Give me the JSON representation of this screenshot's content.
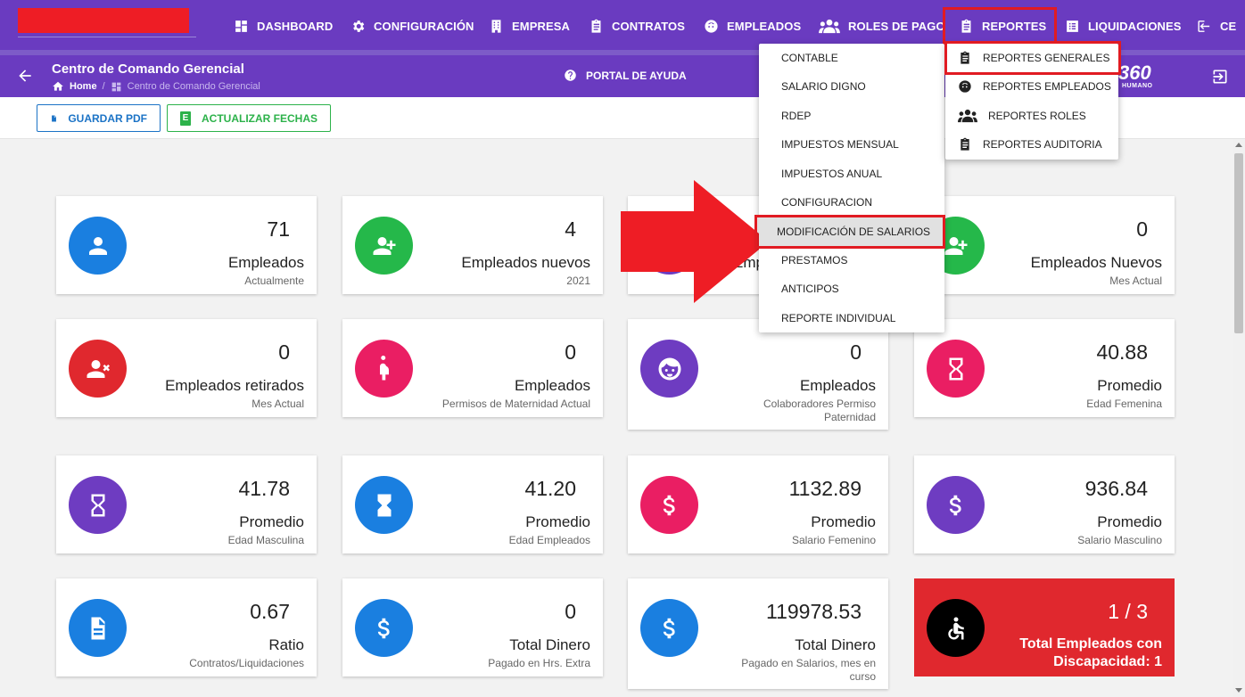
{
  "nav": {
    "items": [
      {
        "label": "DASHBOARD",
        "icon": "dashboard-icon"
      },
      {
        "label": "CONFIGURACIÓN",
        "icon": "gear-icon"
      },
      {
        "label": "EMPRESA",
        "icon": "building-icon"
      },
      {
        "label": "CONTRATOS",
        "icon": "clipboard-icon"
      },
      {
        "label": "EMPLEADOS",
        "icon": "face-icon"
      },
      {
        "label": "ROLES DE PAGO",
        "icon": "group-icon"
      },
      {
        "label": "REPORTES",
        "icon": "clipboard-icon"
      },
      {
        "label": "LIQUIDACIONES",
        "icon": "list-icon"
      },
      {
        "label": "CE",
        "icon": "exit-icon"
      }
    ]
  },
  "subheader": {
    "title": "Centro de Comando Gerencial",
    "breadcrumb_home": "Home",
    "breadcrumb_sep": "/",
    "breadcrumb_current": "Centro de Comando Gerencial",
    "help_label": "PORTAL DE AYUDA",
    "brand": "360",
    "brand_sub": "HUMANO"
  },
  "toolbar": {
    "pdf_label": "GUARDAR PDF",
    "excel_letter": "E",
    "dates_label": "ACTUALIZAR FECHAS"
  },
  "dropdown_contratos": {
    "items": [
      "CONTABLE",
      "SALARIO DIGNO",
      "RDEP",
      "IMPUESTOS MENSUAL",
      "IMPUESTOS ANUAL",
      "CONFIGURACION",
      "MODIFICACIÓN DE SALARIOS",
      "PRESTAMOS",
      "ANTICIPOS",
      "REPORTE INDIVIDUAL"
    ],
    "highlighted": "MODIFICACIÓN DE SALARIOS"
  },
  "dropdown_reportes": {
    "items": [
      {
        "label": "REPORTES GENERALES",
        "icon": "clipboard-icon"
      },
      {
        "label": "REPORTES EMPLEADOS",
        "icon": "face-icon"
      },
      {
        "label": "REPORTES ROLES",
        "icon": "group-icon"
      },
      {
        "label": "REPORTES AUDITORIA",
        "icon": "clipboard-icon"
      }
    ]
  },
  "cards": [
    {
      "value": "71",
      "label": "Empleados",
      "sub": "Actualmente",
      "color": "#1a7fe0",
      "icon": "person-icon"
    },
    {
      "value": "4",
      "label": "Empleados nuevos",
      "sub": "2021",
      "color": "#25b84a",
      "icon": "person-add-icon"
    },
    {
      "value": "",
      "label": "Emp",
      "sub": "",
      "color": "#6a3bc0",
      "icon": "person-icon"
    },
    {
      "value": "0",
      "label": "Empleados Nuevos",
      "sub": "Mes Actual",
      "color": "#25b84a",
      "icon": "person-add-icon"
    },
    {
      "value": "0",
      "label": "Empleados retirados",
      "sub": "Mes Actual",
      "color": "#e0282e",
      "icon": "person-remove-icon"
    },
    {
      "value": "0",
      "label": "Empleados",
      "sub": "Permisos de Maternidad Actual",
      "color": "#ea1e63",
      "icon": "pregnant-icon"
    },
    {
      "value": "0",
      "label": "Empleados",
      "sub": "Colaboradores Permiso Paternidad",
      "color": "#6e3cc1",
      "icon": "child-face-icon"
    },
    {
      "value": "40.88",
      "label": "Promedio",
      "sub": "Edad Femenina",
      "color": "#ea1e63",
      "icon": "hourglass-icon"
    },
    {
      "value": "41.78",
      "label": "Promedio",
      "sub": "Edad Masculina",
      "color": "#6e3cc1",
      "icon": "hourglass-icon"
    },
    {
      "value": "41.20",
      "label": "Promedio",
      "sub": "Edad Empleados",
      "color": "#1a7fe0",
      "icon": "hourglass-full-icon"
    },
    {
      "value": "1132.89",
      "label": "Promedio",
      "sub": "Salario Femenino",
      "color": "#ea1e63",
      "icon": "dollar-icon"
    },
    {
      "value": "936.84",
      "label": "Promedio",
      "sub": "Salario Masculino",
      "color": "#6e3cc1",
      "icon": "dollar-icon"
    },
    {
      "value": "0.67",
      "label": "Ratio",
      "sub": "Contratos/Liquidaciones",
      "color": "#1a7fe0",
      "icon": "document-icon"
    },
    {
      "value": "0",
      "label": "Total Dinero",
      "sub": "Pagado en Hrs. Extra",
      "color": "#1a7fe0",
      "icon": "dollar-icon"
    },
    {
      "value": "119978.53",
      "label": "Total Dinero",
      "sub": "Pagado en Salarios, mes en curso",
      "color": "#1a7fe0",
      "icon": "dollar-icon"
    },
    {
      "value": "1 / 3",
      "label": "Total Empleados con Discapacidad: 1",
      "sub": "",
      "color": "#000000",
      "icon": "wheelchair-icon"
    }
  ],
  "colors": {
    "nav_bg": "#6a3bc0",
    "highlight": "#e11b22",
    "pdf": "#1b73c6",
    "excel": "#2cb24a",
    "red_card": "#e0282e"
  }
}
